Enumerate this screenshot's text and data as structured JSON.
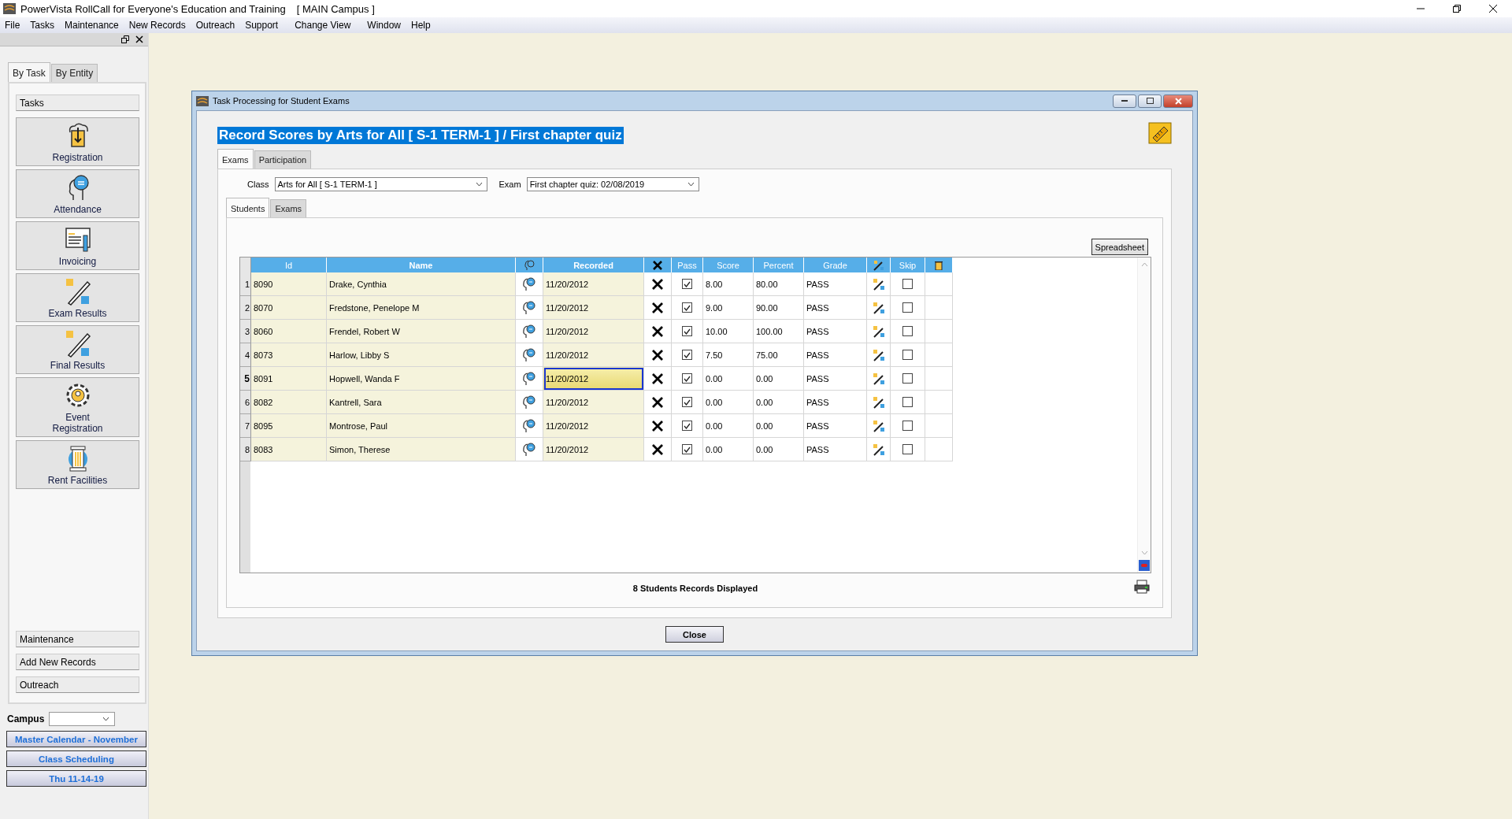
{
  "window": {
    "title": "PowerVista RollCall for Everyone's Education and Training",
    "campus_tag": "[ MAIN Campus ]"
  },
  "menu": [
    "File",
    "Tasks",
    "Maintenance",
    "New Records",
    "Outreach",
    "Support",
    "Change View",
    "Window",
    "Help"
  ],
  "sidebar": {
    "tabs": [
      {
        "label": "By Task",
        "selected": true
      },
      {
        "label": "By Entity",
        "selected": false
      }
    ],
    "section": "Tasks",
    "tasks": [
      {
        "label": "Registration",
        "kind": "upload"
      },
      {
        "label": "Attendance",
        "kind": "head"
      },
      {
        "label": "Invoicing",
        "kind": "invoice"
      },
      {
        "label": "Exam Results",
        "kind": "pencil"
      },
      {
        "label": "Final Results",
        "kind": "pencil"
      },
      {
        "label": "Event Registration",
        "kind": "gear"
      },
      {
        "label": "Rent Facilities",
        "kind": "pillar"
      }
    ],
    "sections": [
      "Maintenance",
      "Add New Records",
      "Outreach"
    ],
    "campus_label": "Campus",
    "links": [
      "Master Calendar - November",
      "Class Scheduling",
      "Thu 11-14-19"
    ]
  },
  "dialog": {
    "title": "Task Processing for Student Exams",
    "heading": "Record Scores by Arts for All [ S-1 TERM-1 ] / First chapter quiz",
    "tabs": [
      {
        "label": "Exams",
        "selected": true
      },
      {
        "label": "Participation",
        "selected": false
      }
    ],
    "class_label": "Class",
    "class_value": "Arts for All [ S-1 TERM-1 ]",
    "exam_label": "Exam",
    "exam_value": "First chapter quiz: 02/08/2019",
    "subtabs": [
      {
        "label": "Students",
        "selected": true
      },
      {
        "label": "Exams",
        "selected": false
      }
    ],
    "spreadsheet_button": "Spreadsheet",
    "columns": [
      {
        "kind": "text",
        "label": "Id",
        "bold": false
      },
      {
        "kind": "text",
        "label": "Name",
        "bold": true
      },
      {
        "kind": "head"
      },
      {
        "kind": "text",
        "label": "Recorded",
        "bold": true
      },
      {
        "kind": "cross"
      },
      {
        "kind": "text",
        "label": "Pass",
        "bold": false
      },
      {
        "kind": "text",
        "label": "Score",
        "bold": false
      },
      {
        "kind": "text",
        "label": "Percent",
        "bold": false
      },
      {
        "kind": "text",
        "label": "Grade",
        "bold": false
      },
      {
        "kind": "wand"
      },
      {
        "kind": "text",
        "label": "Skip",
        "bold": false
      },
      {
        "kind": "trash"
      }
    ],
    "rows": [
      {
        "number": "1",
        "id": "8090",
        "name": "Drake, Cynthia",
        "recorded": "11/20/2012",
        "pass": true,
        "score": "8.00",
        "percent": "80.00",
        "grade": "PASS",
        "skip": false,
        "selected": false
      },
      {
        "number": "2",
        "id": "8070",
        "name": "Fredstone, Penelope M",
        "recorded": "11/20/2012",
        "pass": true,
        "score": "9.00",
        "percent": "90.00",
        "grade": "PASS",
        "skip": false,
        "selected": false
      },
      {
        "number": "3",
        "id": "8060",
        "name": "Frendel, Robert W",
        "recorded": "11/20/2012",
        "pass": true,
        "score": "10.00",
        "percent": "100.00",
        "grade": "PASS",
        "skip": false,
        "selected": false
      },
      {
        "number": "4",
        "id": "8073",
        "name": "Harlow, Libby S",
        "recorded": "11/20/2012",
        "pass": true,
        "score": "7.50",
        "percent": "75.00",
        "grade": "PASS",
        "skip": false,
        "selected": false
      },
      {
        "number": "5",
        "id": "8091",
        "name": "Hopwell, Wanda F",
        "recorded": "11/20/2012",
        "pass": true,
        "score": "0.00",
        "percent": "0.00",
        "grade": "PASS",
        "skip": false,
        "selected": true
      },
      {
        "number": "6",
        "id": "8082",
        "name": "Kantrell, Sara",
        "recorded": "11/20/2012",
        "pass": true,
        "score": "0.00",
        "percent": "0.00",
        "grade": "PASS",
        "skip": false,
        "selected": false
      },
      {
        "number": "7",
        "id": "8095",
        "name": "Montrose, Paul",
        "recorded": "11/20/2012",
        "pass": true,
        "score": "0.00",
        "percent": "0.00",
        "grade": "PASS",
        "skip": false,
        "selected": false
      },
      {
        "number": "8",
        "id": "8083",
        "name": "Simon, Therese",
        "recorded": "11/20/2012",
        "pass": true,
        "score": "0.00",
        "percent": "0.00",
        "grade": "PASS",
        "skip": false,
        "selected": false
      }
    ],
    "status": "8 Students Records Displayed",
    "close_button": "Close"
  }
}
